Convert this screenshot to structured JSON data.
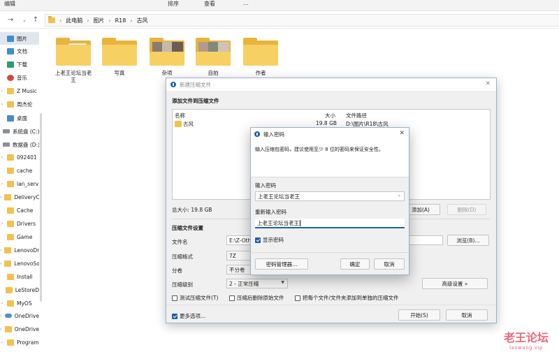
{
  "explorer": {
    "topstrip": [
      "编辑",
      "排序",
      "查看",
      "..."
    ],
    "breadcrumb": [
      "此电脑",
      "图片",
      "R18",
      "古风"
    ],
    "sidebar": [
      {
        "label": "图片",
        "icon": "pictures-icon"
      },
      {
        "label": "文档",
        "icon": "documents-icon"
      },
      {
        "label": "下载",
        "icon": "downloads-icon"
      },
      {
        "label": "音乐",
        "icon": "music-icon"
      },
      {
        "label": "Z Music",
        "icon": "folder-icon"
      },
      {
        "label": "周杰伦",
        "icon": "folder-icon"
      },
      {
        "label": "桌面",
        "icon": "desktop-icon"
      },
      {
        "label": "系统盘 (C:)",
        "icon": "drive-icon"
      },
      {
        "label": "数据盘 (D:)",
        "icon": "drive-icon"
      },
      {
        "label": "092401",
        "icon": "folder-icon"
      },
      {
        "label": "cache",
        "icon": "folder-icon"
      },
      {
        "label": "lan_serv",
        "icon": "folder-icon"
      },
      {
        "label": "DeliveryC",
        "icon": "folder-icon"
      },
      {
        "label": "Cache",
        "icon": "folder-icon"
      },
      {
        "label": "Drivers",
        "icon": "folder-icon"
      },
      {
        "label": "Game",
        "icon": "folder-icon"
      },
      {
        "label": "LenovoDr",
        "icon": "folder-icon"
      },
      {
        "label": "LenovoSo",
        "icon": "folder-icon"
      },
      {
        "label": "Install",
        "icon": "folder-icon"
      },
      {
        "label": "LeStoreD",
        "icon": "folder-icon"
      },
      {
        "label": "MyOS",
        "icon": "folder-icon"
      },
      {
        "label": "OneDrive",
        "icon": "onedrive-icon"
      },
      {
        "label": "OneDrive",
        "icon": "folder-icon"
      },
      {
        "label": "Program",
        "icon": "folder-icon"
      }
    ],
    "folders": [
      {
        "label": "上老王论坛当老王",
        "kind": "paper"
      },
      {
        "label": "写真",
        "kind": "plain"
      },
      {
        "label": "杂项",
        "kind": "photo"
      },
      {
        "label": "自拍",
        "kind": "photo"
      },
      {
        "label": "作者",
        "kind": "plain"
      }
    ]
  },
  "archive_dialog": {
    "title": "新建压缩文件",
    "section_add": "添加文件到压缩文件",
    "col_name": "名称",
    "col_size": "大小",
    "col_path": "文件路径",
    "row": {
      "name": "古风",
      "size": "19.8 GB",
      "path": "D:\\图片\\R18\\古风"
    },
    "total": "总大小: 19.8 GB",
    "add_btn": "添加(A)",
    "delete_btn": "删除(D)",
    "section_settings": "压缩文件设置",
    "filename_label": "文件名",
    "filename_value": "E:\\Z-Othe",
    "browse_btn": "浏览(B)...",
    "format_label": "压缩格式",
    "format_value": "7Z",
    "split_label": "分卷",
    "split_value": "不分卷",
    "level_label": "压缩级别",
    "level_value": "2 - 正常压缩",
    "advanced_btn": "高级设置 »",
    "test_chk": "测试压缩文件(T)",
    "delete_chk": "压缩后删除原始文件",
    "each_chk": "把每个文件/文件夹添加到单独的压缩文件",
    "more_chk": "更多选项...",
    "start_btn": "开始(S)",
    "cancel_btn": "取消"
  },
  "password_dialog": {
    "title": "输入密码",
    "hint": "输入压缩包密码，建议使用至少 8 位的密码来保证安全性。",
    "pwd_label": "输入密码",
    "pwd_value": "上老王论坛当老王",
    "repeat_label": "重新输入密码",
    "repeat_value": "上老王论坛当老王",
    "show_chk": "显示密码",
    "manager_btn": "密码管理器...",
    "ok_btn": "确定",
    "cancel_btn": "取消"
  },
  "watermark": {
    "line1": "老王论坛",
    "line2": "laowang.vip"
  }
}
